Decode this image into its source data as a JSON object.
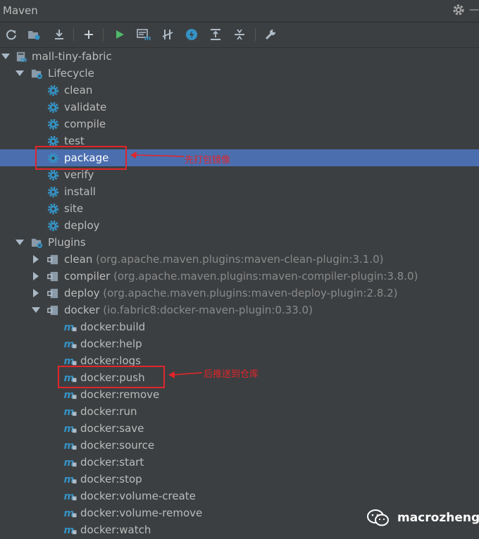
{
  "panel": {
    "title": "Maven"
  },
  "toolbar": {
    "buttons": [
      "reload-icon",
      "open-folder-icon",
      "download-icon",
      "add-icon",
      "run-icon",
      "execute-goal-icon",
      "toggle-offline-icon",
      "lightning-icon",
      "collapse-all-icon",
      "expand-all-icon",
      "wrench-icon"
    ]
  },
  "tree": {
    "project": "mall-tiny-fabric",
    "lifecycle": {
      "label": "Lifecycle",
      "phases": [
        "clean",
        "validate",
        "compile",
        "test",
        "package",
        "verify",
        "install",
        "site",
        "deploy"
      ],
      "selected": "package"
    },
    "plugins": {
      "label": "Plugins",
      "items": [
        {
          "name": "clean",
          "detail": "(org.apache.maven.plugins:maven-clean-plugin:3.1.0)"
        },
        {
          "name": "compiler",
          "detail": "(org.apache.maven.plugins:maven-compiler-plugin:3.8.0)"
        },
        {
          "name": "deploy",
          "detail": "(org.apache.maven.plugins:maven-deploy-plugin:2.8.2)"
        },
        {
          "name": "docker",
          "detail": "(io.fabric8:docker-maven-plugin:0.33.0)"
        }
      ],
      "docker_goals": [
        "docker:build",
        "docker:help",
        "docker:logs",
        "docker:push",
        "docker:remove",
        "docker:run",
        "docker:save",
        "docker:source",
        "docker:start",
        "docker:stop",
        "docker:volume-create",
        "docker:volume-remove",
        "docker:watch"
      ]
    }
  },
  "annotations": {
    "package_note": "先打包镜像",
    "push_note": "后推送到仓库",
    "color": "#e0262b"
  },
  "watermark": {
    "text": "macrozheng"
  }
}
